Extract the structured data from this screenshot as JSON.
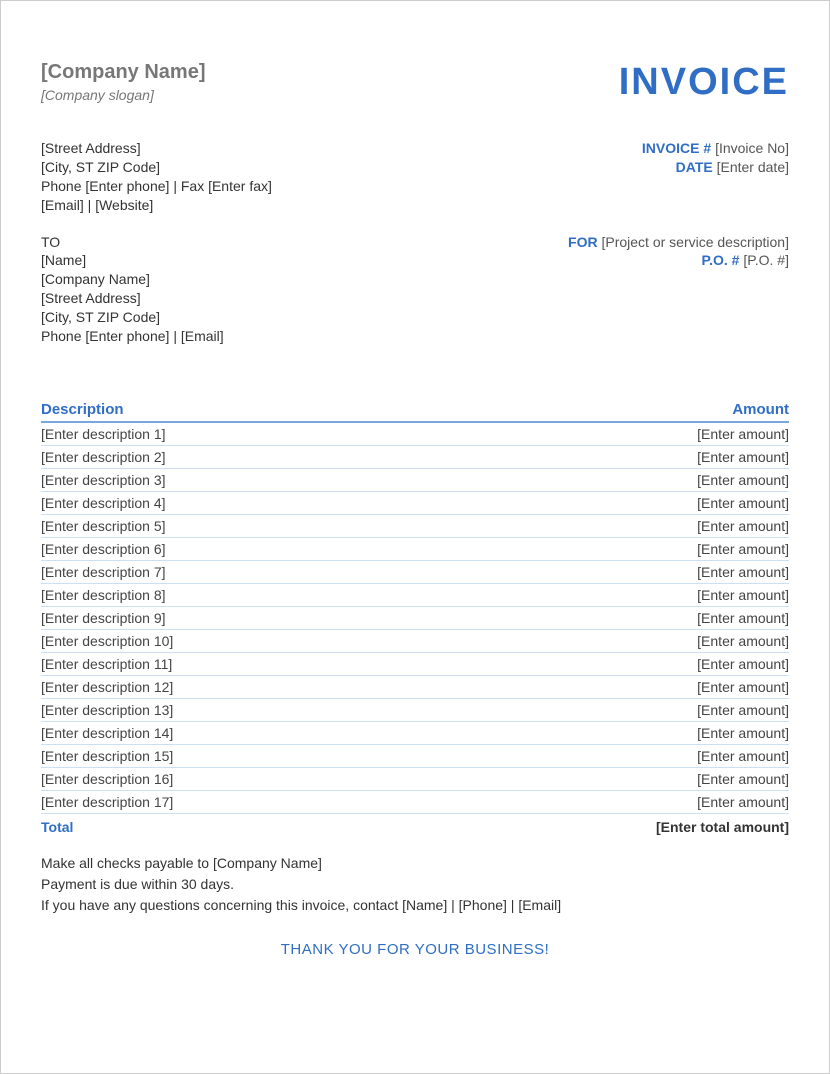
{
  "header": {
    "company_name": "[Company Name]",
    "company_slogan": "[Company slogan]",
    "invoice_title": "INVOICE"
  },
  "from": {
    "street": "[Street Address]",
    "city_line": "[City, ST ZIP Code]",
    "phone_line": "Phone [Enter phone]  |  Fax [Enter fax]",
    "contact_line": "[Email]  |  [Website]"
  },
  "meta": {
    "invoice_no_label": "INVOICE #",
    "invoice_no_value": "[Invoice No]",
    "date_label": "DATE",
    "date_value": "[Enter date]"
  },
  "to": {
    "to_label": "TO",
    "name": "[Name]",
    "company": "[Company Name]",
    "street": "[Street Address]",
    "city_line": "[City, ST ZIP Code]",
    "phone_line": "Phone [Enter phone]  |  [Email]"
  },
  "for": {
    "for_label": "FOR",
    "for_value": "[Project or service description]",
    "po_label": "P.O. #",
    "po_value": "[P.O. #]"
  },
  "table": {
    "desc_header": "Description",
    "amount_header": "Amount",
    "items": [
      {
        "desc": "[Enter description 1]",
        "amount": "[Enter amount]"
      },
      {
        "desc": "[Enter description 2]",
        "amount": "[Enter amount]"
      },
      {
        "desc": "[Enter description 3]",
        "amount": "[Enter amount]"
      },
      {
        "desc": "[Enter description 4]",
        "amount": "[Enter amount]"
      },
      {
        "desc": "[Enter description 5]",
        "amount": "[Enter amount]"
      },
      {
        "desc": "[Enter description 6]",
        "amount": "[Enter amount]"
      },
      {
        "desc": "[Enter description 7]",
        "amount": "[Enter amount]"
      },
      {
        "desc": "[Enter description 8]",
        "amount": "[Enter amount]"
      },
      {
        "desc": "[Enter description 9]",
        "amount": "[Enter amount]"
      },
      {
        "desc": "[Enter description 10]",
        "amount": "[Enter amount]"
      },
      {
        "desc": "[Enter description 11]",
        "amount": "[Enter amount]"
      },
      {
        "desc": "[Enter description 12]",
        "amount": "[Enter amount]"
      },
      {
        "desc": "[Enter description 13]",
        "amount": "[Enter amount]"
      },
      {
        "desc": "[Enter description 14]",
        "amount": "[Enter amount]"
      },
      {
        "desc": "[Enter description 15]",
        "amount": "[Enter amount]"
      },
      {
        "desc": "[Enter description 16]",
        "amount": "[Enter amount]"
      },
      {
        "desc": "[Enter description 17]",
        "amount": "[Enter amount]"
      }
    ],
    "total_label": "Total",
    "total_value": "[Enter total amount]"
  },
  "notes": {
    "line1": "Make all checks payable to [Company Name]",
    "line2": "Payment is due within 30 days.",
    "line3": "If you have any questions concerning this invoice, contact [Name]  |  [Phone]  |  [Email]"
  },
  "thanks": "THANK YOU FOR YOUR BUSINESS!"
}
